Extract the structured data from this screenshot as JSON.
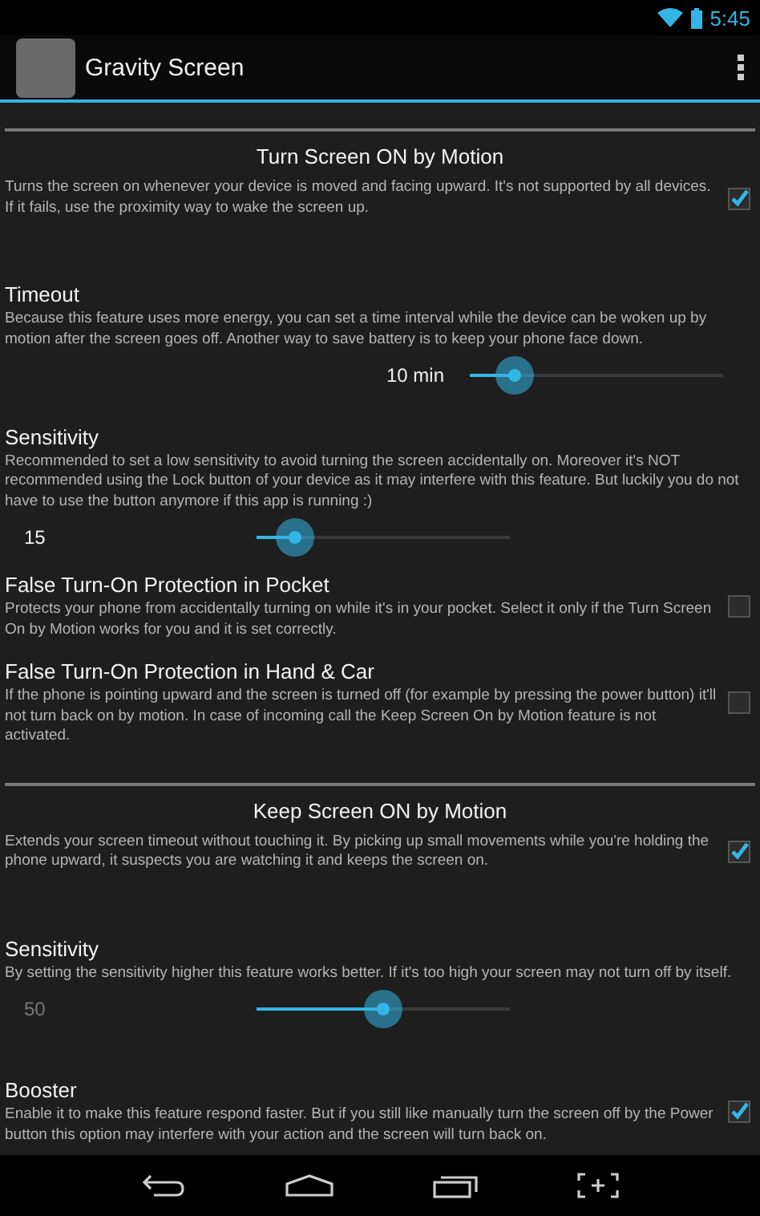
{
  "status_bar": {
    "time": "5:45"
  },
  "action_bar": {
    "title": "Gravity Screen"
  },
  "items": [
    {
      "kind": "divider"
    },
    {
      "kind": "header-checkbox",
      "title": "Turn Screen ON by Motion",
      "description": "Turns the screen on whenever your device is moved and facing upward. It's not supported by all devices. If it fails, use the proximity way to wake the screen up.",
      "checked": true
    },
    {
      "kind": "slider-end",
      "title": "Timeout",
      "description": "Because this feature uses more energy, you can set a time interval while the device can be woken up by motion after the screen goes off. Another way to save battery is to keep your phone face down.",
      "value": "10 min",
      "level": 0.18,
      "disabled": false
    },
    {
      "kind": "slider",
      "title": "Sensitivity",
      "description": "Recommended to set a low sensitivity to avoid turning the screen accidentally on. Moreover it's NOT recommended using the Lock button of your device as it may interfere with this feature. But luckily you do not have to use the button anymore if this app is running :)",
      "value": "15",
      "level": 0.15,
      "disabled": false
    },
    {
      "kind": "checkbox",
      "title": "False Turn-On Protection in Pocket",
      "description": "Protects your phone from accidentally turning on while it's in your pocket. Select it only if the Turn Screen On by Motion works for you and it is set correctly.",
      "checked": false
    },
    {
      "kind": "checkbox",
      "title": "False Turn-On Protection in Hand & Car",
      "description": "If the phone is pointing upward and the screen is turned off (for example by pressing the power button) it'll not turn back on by motion. In case of incoming call the Keep Screen On by Motion feature is not activated.",
      "checked": false
    },
    {
      "kind": "divider"
    },
    {
      "kind": "header-checkbox",
      "title": "Keep Screen ON by Motion",
      "description": "Extends your screen timeout without touching it. By picking up small movements while you're holding the phone upward, it suspects you are watching it and keeps the screen on.",
      "checked": true
    },
    {
      "kind": "slider",
      "title": "Sensitivity",
      "description": "By setting the sensitivity higher this feature works better. If it's too high your screen may not turn off by itself.",
      "value": "50",
      "level": 0.5,
      "disabled": true
    },
    {
      "kind": "checkbox",
      "title": "Booster",
      "description": "Enable it to make this feature respond faster. But if you still like manually turn the screen off by the Power button this option may interfere with your action and the screen will turn back on.",
      "checked": true
    }
  ]
}
